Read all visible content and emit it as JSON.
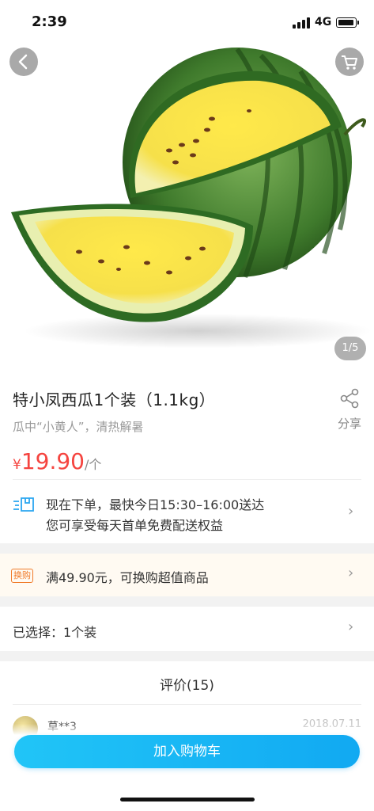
{
  "status_bar": {
    "time": "2:39",
    "network": "4G"
  },
  "gallery": {
    "pager": "1/5"
  },
  "product": {
    "title": "特小凤西瓜1个装（1.1kg）",
    "subtitle": "瓜中“小黄人”，清热解暑",
    "share_label": "分享",
    "price_currency": "¥",
    "price_value": "19.90",
    "price_unit": "/个"
  },
  "delivery": {
    "line1": "现在下单，最快今日15:30–16:00送达",
    "line2": "您可享受每天首单免费配送权益"
  },
  "promo": {
    "badge": "换购",
    "text": "满49.90元，可换购超值商品"
  },
  "selection": {
    "text": "已选择：1个装"
  },
  "reviews": {
    "title": "评价(15)",
    "first": {
      "user": "草**3",
      "date": "2018.07.11"
    }
  },
  "actions": {
    "add_to_cart": "加入购物车"
  },
  "colors": {
    "price_red": "#f5443f",
    "accent_blue": "#11a9f2",
    "promo_orange": "#f07b2a"
  },
  "icons": [
    "back-icon",
    "cart-icon",
    "share-icon",
    "delivery-icon",
    "chevron-right-icon"
  ]
}
